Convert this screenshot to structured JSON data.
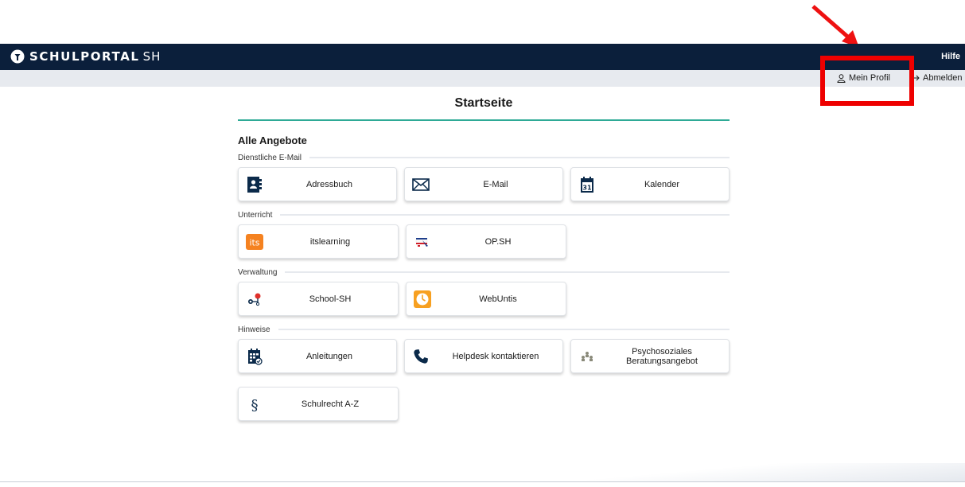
{
  "header": {
    "logo_text": "SCHULPORTAL",
    "logo_suffix": "SH",
    "help_label": "Hilfe",
    "profile_label": "Mein Profil",
    "logout_label": "Abmelden"
  },
  "main": {
    "page_title": "Startseite",
    "section_title": "Alle Angebote",
    "categories": [
      {
        "label": "Dienstliche E-Mail",
        "tiles": [
          {
            "label": "Adressbuch",
            "icon": "address-book-icon"
          },
          {
            "label": "E-Mail",
            "icon": "envelope-icon"
          },
          {
            "label": "Kalender",
            "icon": "calendar-icon"
          }
        ]
      },
      {
        "label": "Unterricht",
        "tiles": [
          {
            "label": "itslearning",
            "icon": "itslearning-icon"
          },
          {
            "label": "OP.SH",
            "icon": "opsh-icon"
          }
        ]
      },
      {
        "label": "Verwaltung",
        "tiles": [
          {
            "label": "School-SH",
            "icon": "school-sh-icon"
          },
          {
            "label": "WebUntis",
            "icon": "webuntis-icon"
          }
        ]
      },
      {
        "label": "Hinweise",
        "tiles": [
          {
            "label": "Anleitungen",
            "icon": "guide-calendar-icon"
          },
          {
            "label": "Helpdesk kontaktieren",
            "icon": "phone-icon"
          },
          {
            "label": "Psychosoziales Beratungsangebot",
            "icon": "counseling-icon"
          },
          {
            "label": "Schulrecht A-Z",
            "icon": "paragraph-icon"
          }
        ]
      }
    ],
    "colors": {
      "topbar": "#0b1f3b",
      "accent": "#2eaa96",
      "highlight": "#ee0000"
    }
  }
}
